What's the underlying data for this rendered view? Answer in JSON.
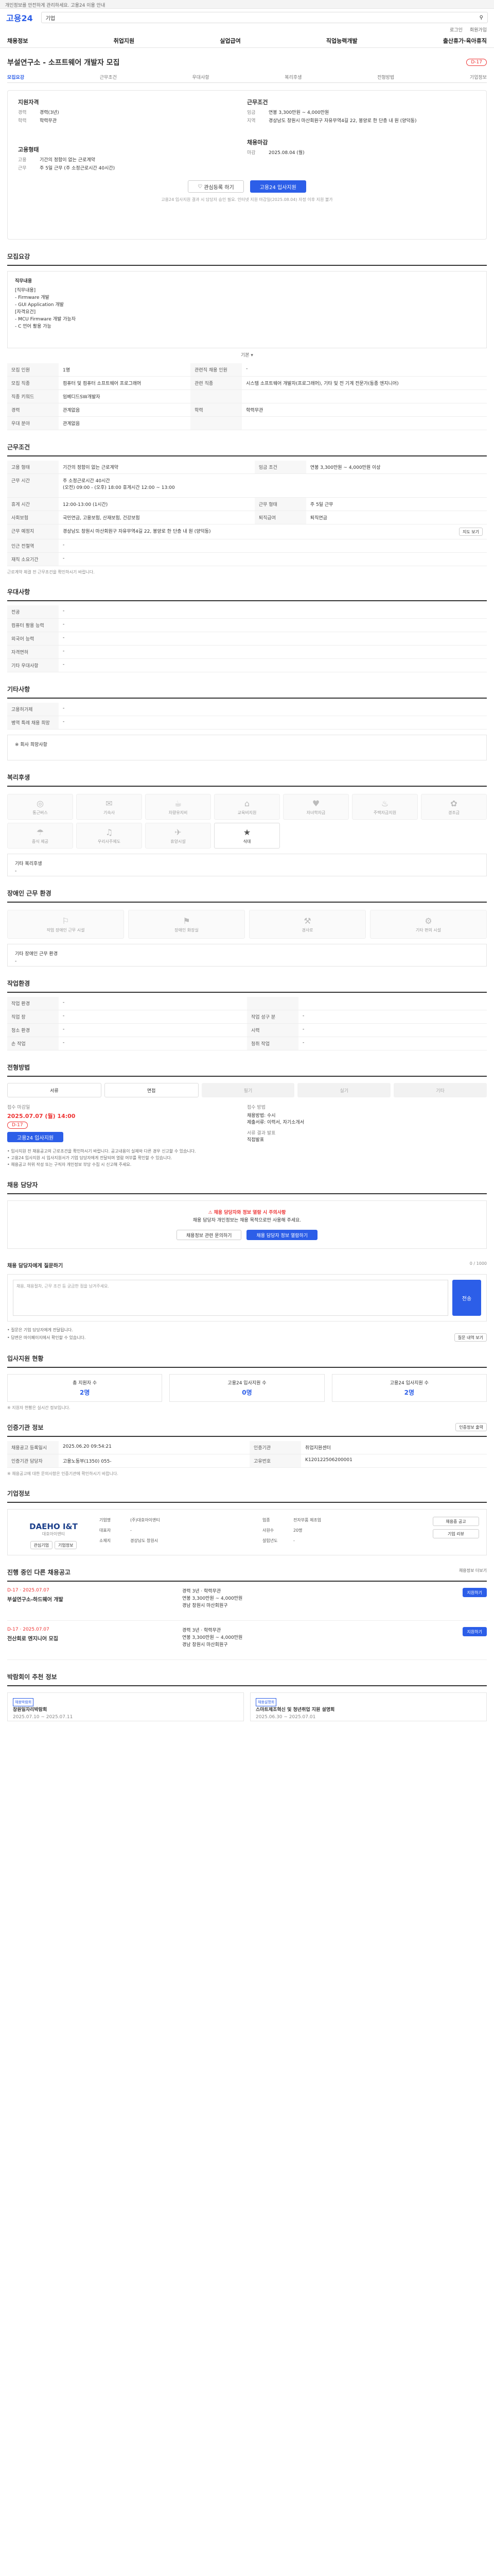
{
  "notice": "개인정보를 안전하게 관리하세요. 고용24 이용 안내",
  "header": {
    "logo": "고용24",
    "search_value": "기업",
    "search_icon": "search-icon",
    "login_links": [
      "로그인",
      "회원가입"
    ]
  },
  "nav": [
    "채용정보",
    "취업지원",
    "실업급여",
    "직업능력개발",
    "출산휴가·육아휴직"
  ],
  "job": {
    "title": "부설연구소 - 소프트웨어 개발자 모집",
    "dday": "D-17"
  },
  "tabs": [
    "모집요강",
    "근무조건",
    "우대사항",
    "복리후생",
    "전형방법",
    "기업정보"
  ],
  "summary": {
    "left_cap": "지원자격",
    "left_rows": [
      {
        "k": "경력",
        "v": "경력(3년)"
      },
      {
        "k": "학력",
        "v": "학력무관"
      }
    ],
    "left_cap2": "고용형태",
    "left_rows2": [
      {
        "k": "고용",
        "v": "기간의 정함이 없는 근로계약"
      },
      {
        "k": "근무",
        "v": "주 5일 근무 (주 소정근로시간 40시간)"
      }
    ],
    "right_cap": "근무조건",
    "right_rows": [
      {
        "k": "임금",
        "v": "연봉 3,300만원 ~ 4,000만원"
      },
      {
        "k": "지역",
        "v": "경상남도 창원시 마산회원구 자유무역4길 22, 봉양로 한 단층 내 원 (양덕동)"
      }
    ],
    "right_cap2": "채용마감",
    "right_rows2": [
      {
        "k": "마감",
        "v": "2025.08.04 (월)"
      }
    ],
    "btn_like": "관심등록 하기",
    "btn_apply": "고용24 입사지원",
    "note": "고용24 입사지원 결과 시 담당자 승인 필요. 인터넷 지원 마감일(2025.08.04) 자정 이후 지원 불가"
  },
  "recruit": {
    "title": "모집요강",
    "desc_cap": "직무내용",
    "desc_lines": [
      "[직무내용]",
      "- Firmware 개발",
      "- GUI Application 개발",
      "",
      "[자격요건]",
      "- MCU Firmware 개발 가능자",
      "- C 언어 활용 가능"
    ],
    "collapse": "기본 ▾",
    "rows": [
      {
        "k": "모집 인원",
        "v": "1명",
        "k2": "관련직 채용 인원",
        "v2": "-"
      },
      {
        "k": "모집 직종",
        "v": "컴퓨터 및 컴퓨터 소프트웨어 프로그래머",
        "k2": "관련 직종",
        "v2": "시스템 소프트웨어 개발자(프로그래머), 기타 및 전 기계 전문가(동종 엔지니어)"
      },
      {
        "k": "직종 키워드",
        "v": "임베디드SW개발자",
        "k2": "",
        "v2": ""
      },
      {
        "k": "경력",
        "v": "관계없음",
        "k2": "학력",
        "v2": "학력무관"
      },
      {
        "k": "우대 분야",
        "v": "관계없음",
        "k2": "",
        "v2": ""
      }
    ]
  },
  "work": {
    "title": "근무조건",
    "rows": [
      {
        "k": "고용 형태",
        "v": "기간의 정함이 없는 근로계약",
        "k2": "임금 조건",
        "v2": "연봉 3,300만원 ~ 4,000만원 이상"
      },
      {
        "k": "근무 시간",
        "v": "주 소정근로시간 40시간",
        "k2": "",
        "v2": ""
      },
      {
        "k": "",
        "v": "(오전) 09:00 - (오후) 18:00 휴게시간 12:00 ~ 13:00",
        "k2": "",
        "v2": ""
      },
      {
        "k": "휴게 시간",
        "v": "12:00-13:00 (1시간)",
        "k2": "근무 형태",
        "v2": "주 5일 근무"
      },
      {
        "k": "사회보험",
        "v": "국민연금, 고용보험, 산재보험, 건강보험",
        "k2": "퇴직급여",
        "v2": "퇴직연금"
      },
      {
        "k": "근무 예정지",
        "v": "경상남도 창원시 마산회원구 자유무역4길 22, 봉양로 한 단층 내 원 (양덕동)",
        "k2": "",
        "v2": ""
      },
      {
        "k": "인근 전철역",
        "v": "-",
        "k2": "",
        "v2": ""
      },
      {
        "k": "재직 소요기간",
        "v": "-",
        "k2": "",
        "v2": ""
      }
    ],
    "map_btn": "지도 보기",
    "note": "근로계약 체결 전 근무조건을 확인하시기 바랍니다."
  },
  "pref": {
    "title": "우대사항",
    "rows": [
      {
        "k": "전공",
        "v": "-"
      },
      {
        "k": "컴퓨터 활용 능력",
        "v": "-"
      },
      {
        "k": "외국어 능력",
        "v": "-"
      },
      {
        "k": "자격면허",
        "v": "-"
      },
      {
        "k": "기타 우대사항",
        "v": "-"
      }
    ]
  },
  "etc": {
    "title": "기타사항",
    "rows": [
      {
        "k": "고용허가제",
        "v": "-"
      },
      {
        "k": "병역 특례 채용 희망",
        "v": "-"
      }
    ],
    "box": "※ 회사 희망사항"
  },
  "welfare": {
    "title": "복리후생",
    "tiles": [
      {
        "i": "◎",
        "t": "통근버스",
        "on": false
      },
      {
        "i": "✉",
        "t": "기숙사",
        "on": false
      },
      {
        "i": "☕",
        "t": "차량유지비",
        "on": false
      },
      {
        "i": "⌂",
        "t": "교육비지원",
        "on": false
      },
      {
        "i": "♥",
        "t": "자녀학자금",
        "on": false
      },
      {
        "i": "♨",
        "t": "주택자금지원",
        "on": false
      },
      {
        "i": "✿",
        "t": "경조금",
        "on": false
      },
      {
        "i": "☂",
        "t": "중식 제공",
        "on": false
      },
      {
        "i": "♫",
        "t": "우리사주제도",
        "on": false
      },
      {
        "i": "✈",
        "t": "휴양시설",
        "on": false
      },
      {
        "i": "★",
        "t": "식대",
        "on": true
      }
    ],
    "box": "기타 복리후생",
    "box_v": "-"
  },
  "env": {
    "title": "장애인 근무 환경",
    "tiles": [
      {
        "i": "⚐",
        "t": "작업 장애인 근무 시설",
        "on": false
      },
      {
        "i": "⚑",
        "t": "장애인 화장실",
        "on": false
      },
      {
        "i": "⚒",
        "t": "경사로",
        "on": false
      },
      {
        "i": "⚙",
        "t": "기타 편의 시설",
        "on": false
      }
    ],
    "box": "기타 장애인 근무 환경",
    "box_v": "-"
  },
  "worktype": {
    "title": "작업환경",
    "rows": [
      {
        "k": "작업 환경",
        "v": "-",
        "k2": "",
        "v2": ""
      },
      {
        "k": "직업 장",
        "v": "-",
        "k2": "작업 성구 분",
        "v2": "-"
      },
      {
        "k": "청소 환경",
        "v": "-",
        "k2": "시력",
        "v2": "-"
      },
      {
        "k": "손 작업",
        "v": "-",
        "k2": "청취 작업",
        "v2": "-"
      }
    ]
  },
  "process": {
    "title": "전형방법",
    "steps": [
      {
        "t": "서류",
        "on": true
      },
      {
        "t": "면접",
        "on": true
      },
      {
        "t": "필기",
        "on": false
      },
      {
        "t": "실기",
        "on": false
      },
      {
        "t": "기타",
        "on": false
      }
    ],
    "p_cap": "접수 마감일",
    "p_date": "2025.07.07 (월) 14:00",
    "p_dday": "D-17",
    "p_btn": "고용24 입사지원",
    "m_cap": "접수 방법",
    "m_v": "채용방법: 수시\n제출서류: 이력서, 자기소개서",
    "r_cap": "서류 결과 발표",
    "r_v": "직접발표"
  },
  "warn": [
    "• 입사지원 전 채용공고의 근로조건을 확인하시기 바랍니다. 공고내용이 실제와 다른 경우 신고할 수 있습니다.",
    "• 고용24 입사지원 시 입사지원서가 기업 담당자에게 전달되며 열람 여부를 확인할 수 있습니다.",
    "• 채용공고 허위 작성 또는 구직자 개인정보 부당 수집 시 신고해 주세요."
  ],
  "contact": {
    "title": "채용 담당자",
    "alert1": "채용 담당자와 정보 열람 시 주의사항",
    "alert2": "채용 담당자 개인정보는 채용 목적으로만 사용해 주세요.",
    "btn1": "채용정보 관련 문의하기",
    "btn2": "채용 담당자 정보 열람하기"
  },
  "qa": {
    "title": "채용 담당자에게 질문하기",
    "placeholder": "채용, 채용절차, 근무 조건 등 궁금한 점을 남겨주세요.",
    "count": "0 / 1000",
    "send": "전송",
    "notes": [
      "• 질문은 기업 담당자에게 전달됩니다.",
      "• 답변은 마이페이지에서 확인할 수 있습니다."
    ],
    "notes_btn": "질문 내역 보기"
  },
  "apply_stats": {
    "title": "입사지원 현황",
    "items": [
      {
        "k": "총 지원자 수",
        "v": "2명"
      },
      {
        "k": "고용24 입사지원 수",
        "v": "0명"
      },
      {
        "k": "고용24 입사지원 수",
        "v": "2명"
      }
    ],
    "note": "※ 지원자 현황은 실시간 정보입니다."
  },
  "cert": {
    "title": "인증기관 정보",
    "print_btn": "인증정보 출력",
    "rows": [
      {
        "k": "채용공고 등록일시",
        "v": "2025.06.20 09:54:21",
        "k2": "인증기관",
        "v2": "취업지원센터"
      },
      {
        "k": "인증기관 담당자",
        "v": "고용노동부(1350) 055-",
        "k2": "고유번호",
        "v2": "K120122506200001"
      }
    ],
    "note": "※ 채용공고에 대한 문의사항은 인증기관에 확인하시기 바랍니다."
  },
  "companyinfo": {
    "title": "기업정보",
    "logo": "DAEHO I&T",
    "logo_sub": "대호아이앤티",
    "btn_a": "관심기업",
    "btn_b": "기업정보",
    "rows": [
      {
        "k": "기업명",
        "v": "(주)대호아이앤티"
      },
      {
        "k": "업종",
        "v": "전자부품 제조업"
      },
      {
        "k": "대표자",
        "v": "-"
      },
      {
        "k": "사원수",
        "v": "20명"
      },
      {
        "k": "소재지",
        "v": "경상남도 창원시"
      },
      {
        "k": "설립년도",
        "v": "-"
      }
    ],
    "right_btns": [
      "채용중 공고",
      "기업 리뷰"
    ]
  },
  "other_jobs": {
    "title": "진행 중인 다른 채용공고",
    "more": "채용정보 더보기",
    "items": [
      {
        "dday": "D-17 · 2025.07.07",
        "title": "부설연구소-하드웨어 개발",
        "m1": "경력 3년 · 학력무관",
        "m2": "연봉 3,300만원 ~ 4,000만원",
        "m3": "경남 창원시 마산회원구",
        "btn": "지원하기"
      },
      {
        "dday": "D-17 · 2025.07.07",
        "title": "전산회로 엔지니어 모집",
        "m1": "경력 3년 · 학력무관",
        "m2": "연봉 3,300만원 ~ 4,000만원",
        "m3": "경남 창원시 마산회원구",
        "btn": "지원하기"
      }
    ]
  },
  "promo": {
    "title": "박람회이 추천 정보",
    "cards": [
      {
        "badge": "채용박람회",
        "t": "창원일자리박람회",
        "d": "2025.07.10 ~ 2025.07.11"
      },
      {
        "badge": "채용설명회",
        "t": "스마트제조혁신 및 청년취업 지원 설명회",
        "d": "2025.06.30 ~ 2025.07.01"
      }
    ]
  }
}
